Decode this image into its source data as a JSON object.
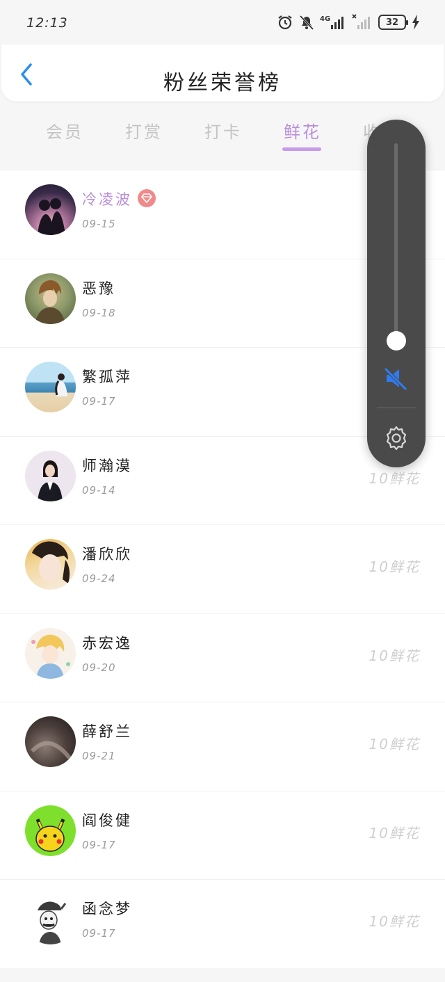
{
  "status_bar": {
    "time": "12:13",
    "network": "4G",
    "battery": "32",
    "icons": [
      "alarm-icon",
      "mute-bell-icon",
      "signal-4g-icon",
      "signal-2-icon",
      "battery-icon",
      "charging-icon"
    ]
  },
  "header": {
    "title": "粉丝荣誉榜",
    "back_icon": "chevron-left-icon",
    "accent_color": "#2a8ff0"
  },
  "tabs": [
    {
      "label": "会员",
      "active": false
    },
    {
      "label": "打赏",
      "active": false
    },
    {
      "label": "打卡",
      "active": false
    },
    {
      "label": "鲜花",
      "active": true
    },
    {
      "label": "收",
      "active": false
    }
  ],
  "tab_active_color": "#b98edb",
  "fans": [
    {
      "name": "冷凌波",
      "date": "09-15",
      "vip": true,
      "flowers": ""
    },
    {
      "name": "恶豫",
      "date": "09-18",
      "vip": false,
      "flowers": ""
    },
    {
      "name": "繁孤萍",
      "date": "09-17",
      "vip": false,
      "flowers": ""
    },
    {
      "name": "师瀚漠",
      "date": "09-14",
      "vip": false,
      "flowers": "10鲜花"
    },
    {
      "name": "潘欣欣",
      "date": "09-24",
      "vip": false,
      "flowers": "10鲜花"
    },
    {
      "name": "赤宏逸",
      "date": "09-20",
      "vip": false,
      "flowers": "10鲜花"
    },
    {
      "name": "薛舒兰",
      "date": "09-21",
      "vip": false,
      "flowers": "10鲜花"
    },
    {
      "name": "阎俊健",
      "date": "09-17",
      "vip": false,
      "flowers": "10鲜花"
    },
    {
      "name": "函念梦",
      "date": "09-17",
      "vip": false,
      "flowers": "10鲜花"
    }
  ],
  "volume_panel": {
    "level": 0.0,
    "muted": true,
    "mute_icon": "speaker-muted-icon",
    "settings_icon": "gear-icon",
    "mute_color": "#2f7cf0"
  }
}
